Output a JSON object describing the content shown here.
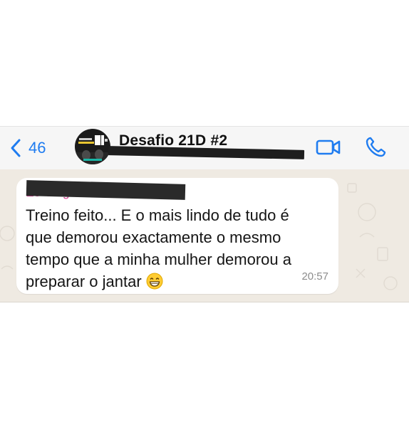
{
  "header": {
    "back_count": "46",
    "group_name": "Desafio 21D #2",
    "icons": {
      "back": "chevron-left-icon",
      "video": "video-camera-icon",
      "call": "phone-icon"
    },
    "accent_color": "#1f7cf0"
  },
  "message": {
    "sender_partial": "Zé Gulga",
    "lines": [
      "Treino feito... E o mais lindo de tudo é",
      "que demorou exactamente o mesmo",
      "tempo que a minha mulher demorou a",
      "preparar o jantar"
    ],
    "emoji": "grinning-face-with-smiling-eyes",
    "time": "20:57"
  }
}
